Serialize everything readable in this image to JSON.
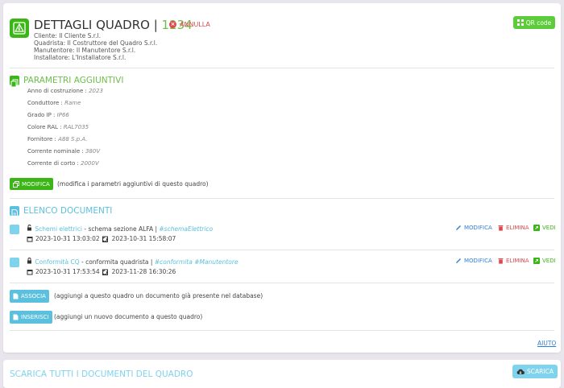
{
  "header": {
    "title": "DETTAGLI QUADRO",
    "separator": "|",
    "number": "1234",
    "cancel_label": "ANNULLA",
    "qr_label": "QR code",
    "info": [
      "Cliente: Il Cliente S.r.l.",
      "Quadrista: Il Costruttore del Quadro S.r.l.",
      "Manutentore: Il Manutentore S.r.l.",
      "Installatore: L'Installatore S.r.l."
    ]
  },
  "params": {
    "title": "PARAMETRI AGGIUNTIVI",
    "items": [
      {
        "label": "Anno di costruzione :",
        "value": "2023"
      },
      {
        "label": "Conduttore :",
        "value": "Rame"
      },
      {
        "label": "Grado IP :",
        "value": "IP66"
      },
      {
        "label": "Colore RAL :",
        "value": "RAL7035"
      },
      {
        "label": "Fornitore :",
        "value": "A88 S.p.A."
      },
      {
        "label": "Corrente nominale :",
        "value": "380V"
      },
      {
        "label": "Corrente di corto :",
        "value": "2000V"
      }
    ],
    "edit_label": "MODIFICA",
    "edit_hint": "(modifica i parametri aggiuntivi di questo quadro)"
  },
  "documents": {
    "title": "ELENCO DOCUMENTI",
    "items": [
      {
        "name": "Schemi elettrici",
        "description": " - schema sezione ALFA | ",
        "tags": "#schemaElettrico",
        "created": "2023-10-31 13:03:02",
        "updated": "2023-10-31 15:58:07"
      },
      {
        "name": "Conformità CQ",
        "description": " - conformita quadrista | ",
        "tags": "#conformita #Manutentore",
        "created": "2023-10-31 17:53:54",
        "updated": "2023-11-28 16:30:26"
      }
    ],
    "actions": {
      "edit": "MODIFICA",
      "delete": "ELIMINA",
      "view": "VEDI"
    },
    "associate_label": "ASSOCIA",
    "associate_hint": "(aggiungi a questo quadro un documento già presente nel database)",
    "insert_label": "INSERISCI",
    "insert_hint": "(aggiungi un nuovo documento a questo quadro)",
    "help_label": "AIUTO"
  },
  "download": {
    "title": "SCARICA TUTTI I DOCUMENTI DEL QUADRO",
    "button_label": "SCARICA"
  },
  "colors": {
    "green": "#3cb517",
    "light_green": "#6cc04a",
    "blue": "#5bc0de",
    "red": "#e0474d",
    "link_blue": "#2f7fd6"
  },
  "icons": {
    "logo": "electrical-panel-icon",
    "cancel": "x-circle-icon",
    "qr": "qr-code-icon",
    "params": "copy-icon",
    "docs": "document-icon",
    "calendar": "calendar-icon",
    "update": "refresh-calendar-icon",
    "edit": "pencil-icon",
    "delete": "trash-icon",
    "view": "external-link-icon",
    "download": "cloud-download-icon"
  }
}
